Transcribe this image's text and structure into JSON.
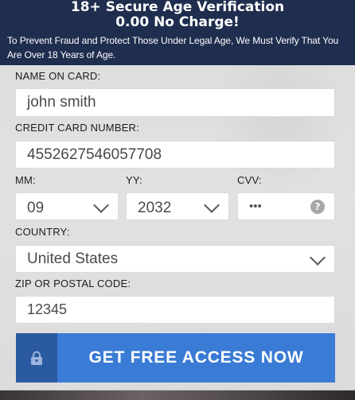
{
  "header": {
    "title_line1": "18+ Secure Age Verification",
    "title_line2": "0.00 No Charge!",
    "notice": "To Prevent Fraud and Protect Those Under Legal Age, We Must Verify That You Are Over 18 Years of Age."
  },
  "form": {
    "name_label": "NAME ON CARD:",
    "name_value": "john smith",
    "card_label": "CREDIT CARD NUMBER:",
    "card_value": "4552627546057708",
    "mm_label": "MM:",
    "mm_value": "09",
    "yy_label": "YY:",
    "yy_value": "2032",
    "cvv_label": "CVV:",
    "cvv_value": "•••",
    "cvv_help": "?",
    "country_label": "COUNTRY:",
    "country_value": "United States",
    "zip_label": "ZIP OR POSTAL CODE:",
    "zip_value": "12345"
  },
  "cta": {
    "label": "GET FREE ACCESS NOW",
    "icon": "lock-icon"
  },
  "colors": {
    "header_bg": "#1f2d4e",
    "button_bg": "#3a7bd5",
    "button_icon_bg": "#2a5aa0"
  }
}
